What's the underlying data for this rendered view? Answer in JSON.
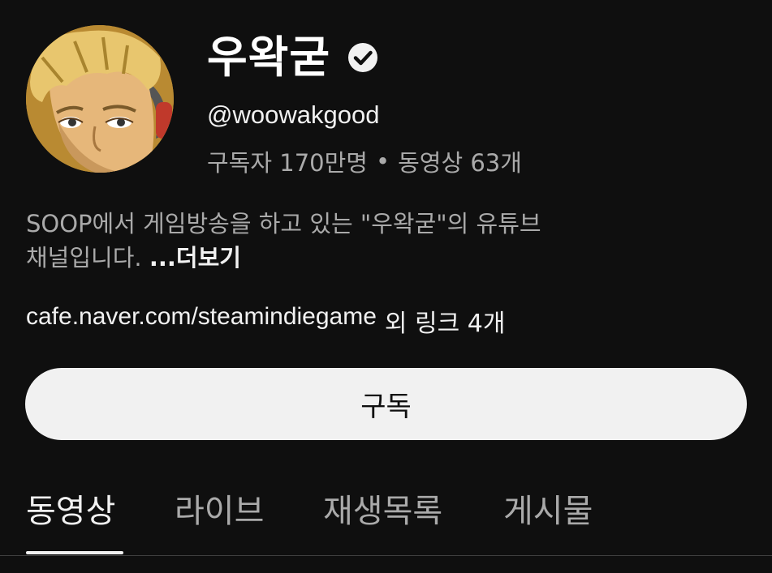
{
  "channel": {
    "name": "우왁굳",
    "verified_icon": "verified-check-icon",
    "handle": "@woowakgood",
    "subscribers": "구독자 170만명",
    "separator": "•",
    "videos": "동영상 63개",
    "description_line1": "SOOP에서 게임방송을 하고 있는 \"우왁굳\"의 유튜브",
    "description_line2": "채널입니다. ",
    "more_label": "...더보기",
    "link_url": "cafe.naver.com/steamindiegame",
    "link_extra": "외 링크 4개"
  },
  "actions": {
    "subscribe_label": "구독"
  },
  "tabs": [
    {
      "label": "동영상",
      "active": true
    },
    {
      "label": "라이브",
      "active": false
    },
    {
      "label": "재생목록",
      "active": false
    },
    {
      "label": "게시물",
      "active": false
    }
  ],
  "colors": {
    "background": "#0f0f0f",
    "primary_text": "#f1f1f1",
    "secondary_text": "#aaaaaa",
    "button_bg": "#f1f1f1"
  }
}
